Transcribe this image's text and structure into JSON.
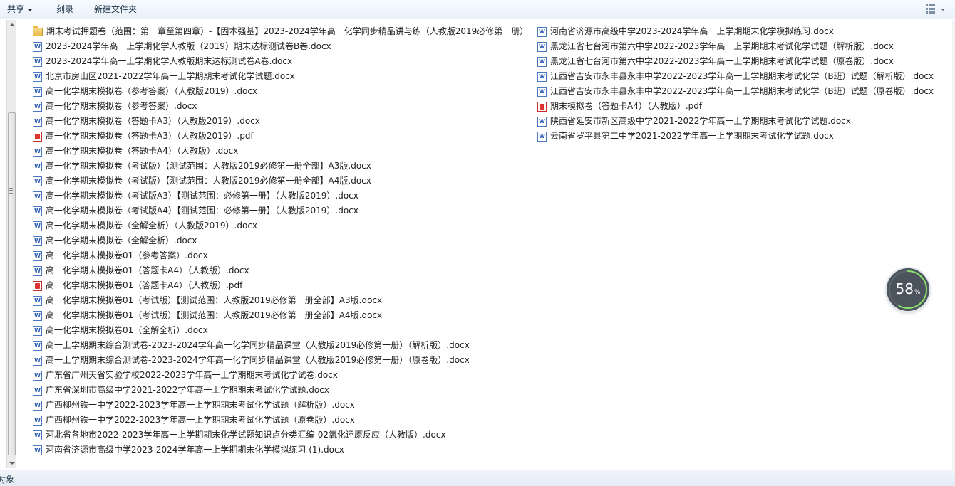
{
  "toolbar": {
    "share_label": "共享",
    "burn_label": "刻录",
    "new_folder_label": "新建文件夹"
  },
  "status_bar": {
    "text": "对象"
  },
  "speed_widget": {
    "value": "58",
    "unit": "%"
  },
  "files": {
    "col1": [
      {
        "name": "期末考试押题卷（范围：第一章至第四章）-【固本强基】2023-2024学年高一化学同步精品讲与练（人教版2019必修第一册）",
        "icon": "folder-icon"
      },
      {
        "name": "2023-2024学年高一上学期化学人教版（2019）期末达标测试卷B卷.docx",
        "icon": "word-icon"
      },
      {
        "name": "2023-2024学年高一上学期化学人教版期末达标测试卷A卷.docx",
        "icon": "word-icon"
      },
      {
        "name": "北京市房山区2021-2022学年高一上学期期末考试化学试题.docx",
        "icon": "word-icon"
      },
      {
        "name": "高一化学期末模拟卷（参考答案）（人教版2019）.docx",
        "icon": "word-icon"
      },
      {
        "name": "高一化学期末模拟卷（参考答案）.docx",
        "icon": "word-icon"
      },
      {
        "name": "高一化学期末模拟卷（答题卡A3）（人教版2019）.docx",
        "icon": "word-icon"
      },
      {
        "name": "高一化学期末模拟卷（答题卡A3）（人教版2019）.pdf",
        "icon": "pdf-icon"
      },
      {
        "name": "高一化学期末模拟卷（答题卡A4）（人教版）.docx",
        "icon": "word-icon"
      },
      {
        "name": "高一化学期末模拟卷（考试版）【测试范围：人教版2019必修第一册全部】A3版.docx",
        "icon": "word-icon"
      },
      {
        "name": "高一化学期末模拟卷（考试版）【测试范围：人教版2019必修第一册全部】A4版.docx",
        "icon": "word-icon"
      },
      {
        "name": "高一化学期末模拟卷（考试版A3）【测试范围：必修第一册】（人教版2019）.docx",
        "icon": "word-icon"
      },
      {
        "name": "高一化学期末模拟卷（考试版A4）【测试范围：必修第一册】（人教版2019）.docx",
        "icon": "word-icon"
      },
      {
        "name": "高一化学期末模拟卷（全解全析）（人教版2019）.docx",
        "icon": "word-icon"
      },
      {
        "name": "高一化学期末模拟卷（全解全析）.docx",
        "icon": "word-icon"
      },
      {
        "name": "高一化学期末模拟卷01（参考答案）.docx",
        "icon": "word-icon"
      },
      {
        "name": "高一化学期末模拟卷01（答题卡A4）（人教版）.docx",
        "icon": "word-icon"
      },
      {
        "name": "高一化学期末模拟卷01（答题卡A4）（人教版）.pdf",
        "icon": "pdf-icon"
      },
      {
        "name": "高一化学期末模拟卷01（考试版）【测试范围：人教版2019必修第一册全部】A3版.docx",
        "icon": "word-icon"
      },
      {
        "name": "高一化学期末模拟卷01（考试版）【测试范围：人教版2019必修第一册全部】A4版.docx",
        "icon": "word-icon"
      },
      {
        "name": "高一化学期末模拟卷01（全解全析）.docx",
        "icon": "word-icon"
      },
      {
        "name": "高一上学期期末综合测试卷-2023-2024学年高一化学同步精品课堂（人教版2019必修第一册）（解析版）.docx",
        "icon": "word-icon"
      },
      {
        "name": "高一上学期期末综合测试卷-2023-2024学年高一化学同步精品课堂（人教版2019必修第一册）（原卷版）.docx",
        "icon": "word-icon"
      },
      {
        "name": "广东省广州天省实验学校2022-2023学年高一上学期期末考试化学试卷.docx",
        "icon": "word-icon"
      },
      {
        "name": "广东省深圳市高级中学2021-2022学年高一上学期期末考试化学试题.docx",
        "icon": "word-icon"
      },
      {
        "name": "广西柳州铁一中学2022-2023学年高一上学期期末考试化学试题（解析版）.docx",
        "icon": "word-icon"
      },
      {
        "name": "广西柳州铁一中学2022-2023学年高一上学期期末考试化学试题（原卷版）.docx",
        "icon": "word-icon"
      },
      {
        "name": "河北省各地市2022-2023学年高一上学期期末化学试题知识点分类汇编-02氧化还原反应（人教版）.docx",
        "icon": "word-icon"
      },
      {
        "name": "河南省济源市高级中学2023-2024学年高一上学期期末化学模拟练习 (1).docx",
        "icon": "word-icon"
      }
    ],
    "col2": [
      {
        "name": "河南省济源市高级中学2023-2024学年高一上学期期末化学模拟练习.docx",
        "icon": "word-icon"
      },
      {
        "name": "黑龙江省七台河市第六中学2022-2023学年高一上学期期末考试化学试题（解析版）.docx",
        "icon": "word-icon"
      },
      {
        "name": "黑龙江省七台河市第六中学2022-2023学年高一上学期期末考试化学试题（原卷版）.docx",
        "icon": "word-icon"
      },
      {
        "name": "江西省吉安市永丰县永丰中学2022-2023学年高一上学期期末考试化学（B班）试题（解析版）.docx",
        "icon": "word-icon"
      },
      {
        "name": "江西省吉安市永丰县永丰中学2022-2023学年高一上学期期末考试化学（B班）试题（原卷版）.docx",
        "icon": "word-icon"
      },
      {
        "name": "期末模拟卷（答题卡A4）（人教版）.pdf",
        "icon": "pdf-icon"
      },
      {
        "name": "陕西省延安市新区高级中学2021-2022学年高一上学期期末考试化学试题.docx",
        "icon": "word-icon"
      },
      {
        "name": "云南省罗平县第二中学2021-2022学年高一上学期期末考试化学试题.docx",
        "icon": "word-icon"
      }
    ]
  }
}
